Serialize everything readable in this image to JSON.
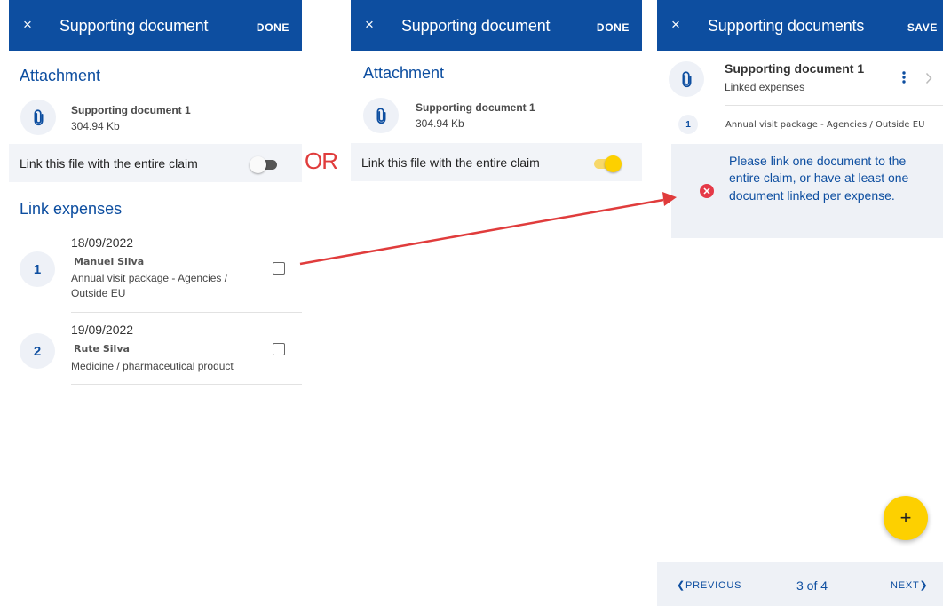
{
  "colors": {
    "header": "#0d4ea0",
    "accent": "#fdd000",
    "arrow": "#e03c3c",
    "error": "#e53947"
  },
  "panel_left": {
    "header": {
      "close_icon": "×",
      "title": "Supporting document",
      "action": "DONE"
    },
    "attachment_title": "Attachment",
    "attachment": {
      "name": "Supporting document 1",
      "size": "304.94 Kb",
      "icon": "paperclip-icon"
    },
    "link_label": "Link this file with the entire claim",
    "link_toggle_on": false,
    "expenses_title": "Link expenses",
    "expenses": [
      {
        "num": "1",
        "date": "18/09/2022",
        "person": "Manuel Silva",
        "desc_line1": "Annual visit package - Agencies /",
        "desc_line2": "Outside EU",
        "checked": false
      },
      {
        "num": "2",
        "date": "19/09/2022",
        "person": "Rute Silva",
        "desc_line1": "Medicine / pharmaceutical product",
        "desc_line2": "",
        "checked": false
      }
    ]
  },
  "or_label": "OR",
  "panel_middle": {
    "header": {
      "close_icon": "×",
      "title": "Supporting document",
      "action": "DONE"
    },
    "attachment_title": "Attachment",
    "attachment": {
      "name": "Supporting document 1",
      "size": "304.94 Kb",
      "icon": "paperclip-icon"
    },
    "link_label": "Link this file with the entire claim",
    "link_toggle_on": true
  },
  "panel_right": {
    "header": {
      "close_icon": "×",
      "title": "Supporting documents",
      "action": "SAVE"
    },
    "document": {
      "name": "Supporting document 1",
      "subtitle": "Linked expenses",
      "icon": "paperclip-icon"
    },
    "linked_expense": {
      "num": "1",
      "label": "Annual visit package - Agencies / Outside EU"
    },
    "error": {
      "icon": "✕",
      "message": "Please link one document to the entire claim, or have at least one document linked per expense."
    },
    "fab_label": "+",
    "pager": {
      "previous": "PREVIOUS",
      "count": "3 of 4",
      "next": "NEXT"
    }
  }
}
